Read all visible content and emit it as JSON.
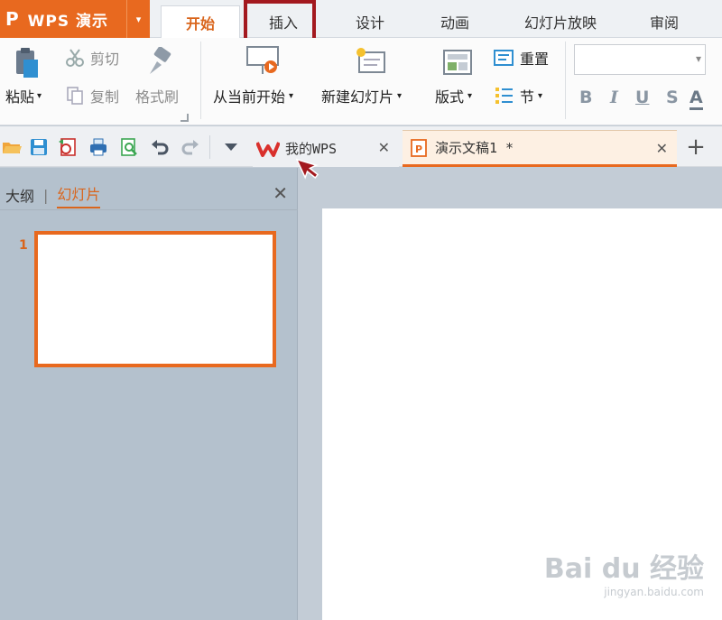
{
  "app": {
    "logo": "P",
    "title": "WPS 演示",
    "dropdown": "▾"
  },
  "menu_tabs": [
    {
      "label": "开始",
      "active": true
    },
    {
      "label": "插入",
      "active": false
    },
    {
      "label": "设计",
      "active": false
    },
    {
      "label": "动画",
      "active": false
    },
    {
      "label": "幻灯片放映",
      "active": false
    },
    {
      "label": "审阅",
      "active": false
    }
  ],
  "ribbon": {
    "paste": "粘贴",
    "cut": "剪切",
    "copy": "复制",
    "format_painter": "格式刷",
    "from_current": "从当前开始",
    "new_slide": "新建幻灯片",
    "layout": "版式",
    "reset": "重置",
    "section": "节",
    "font_bold": "B",
    "font_italic": "I",
    "font_underline": "U",
    "font_strike": "S",
    "font_color": "A"
  },
  "doc_tabs": [
    {
      "label": "我的WPS"
    },
    {
      "label": "演示文稿1 *"
    }
  ],
  "panel": {
    "tab_outline": "大纲",
    "tab_separator": "|",
    "tab_slides": "幻灯片",
    "slide_number": "1"
  },
  "watermark": {
    "logo": "Bai du 经验",
    "url": "jingyan.baidu.com"
  },
  "colors": {
    "accent": "#e8691f",
    "highlight": "#a3191f",
    "panel": "#b4c1cd"
  }
}
